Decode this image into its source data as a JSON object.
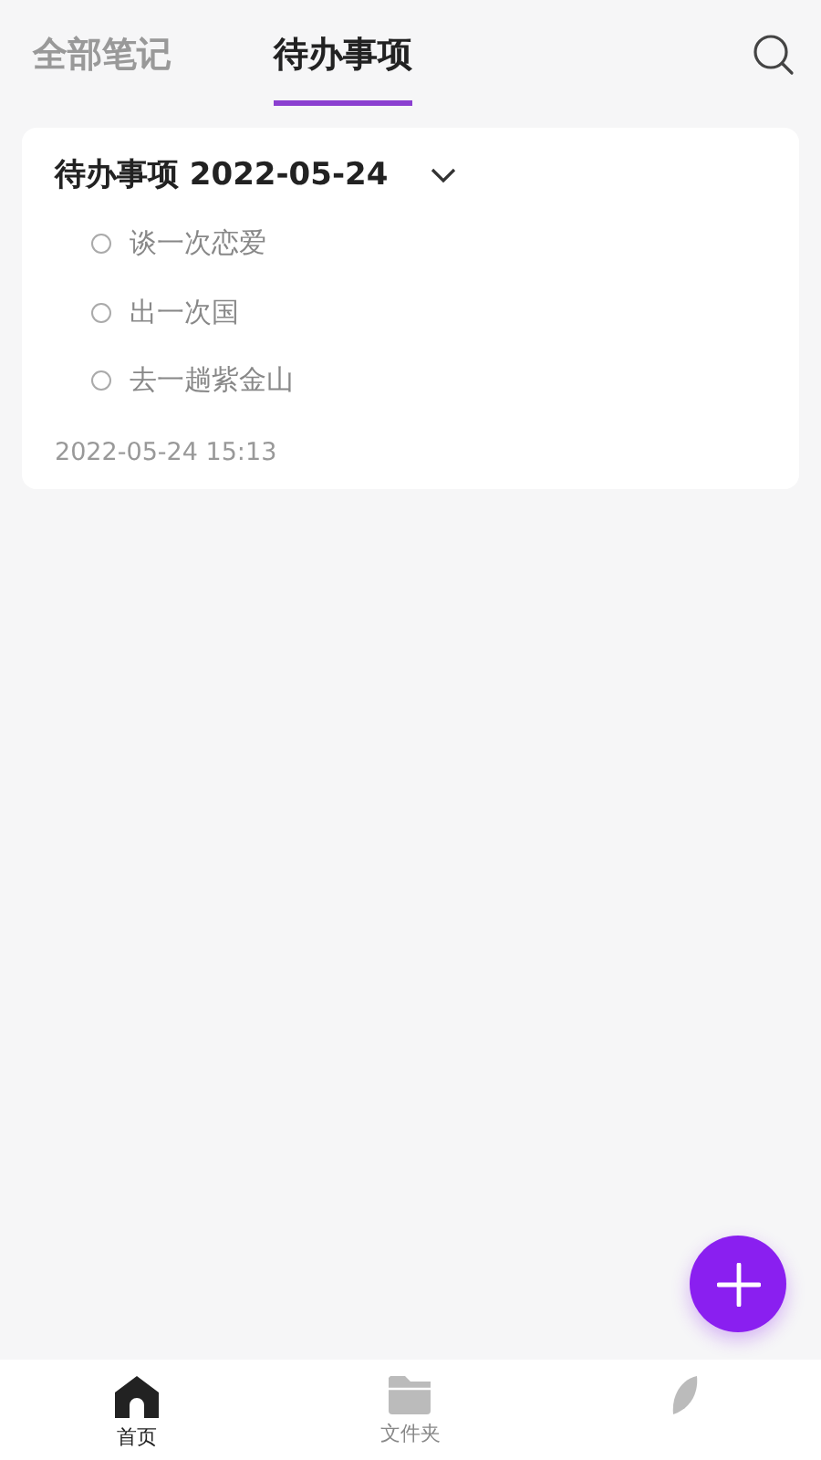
{
  "tabs": [
    {
      "label": "全部笔记",
      "selected": false
    },
    {
      "label": "待办事项",
      "selected": true
    }
  ],
  "todo_card": {
    "title": "待办事项 2022-05-24",
    "expanded": true,
    "items": [
      {
        "text": "谈一次恋爱",
        "checked": false
      },
      {
        "text": "出一次国",
        "checked": false
      },
      {
        "text": "去一趟紫金山",
        "checked": false
      }
    ],
    "timestamp": "2022-05-24 15:13"
  },
  "bottom_nav": [
    {
      "kind": "home",
      "label": "首页",
      "selected": true
    },
    {
      "kind": "folder",
      "label": "文件夹",
      "selected": false
    },
    {
      "kind": "leaf",
      "selected": false
    }
  ]
}
